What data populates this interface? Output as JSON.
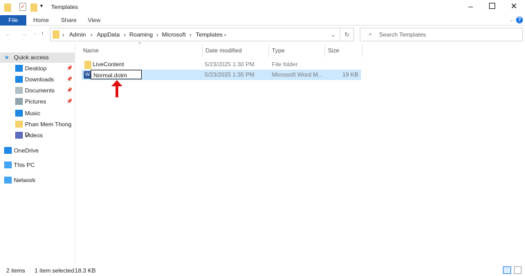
{
  "window": {
    "title": "Templates"
  },
  "ribbon": {
    "tabs": [
      "File",
      "Home",
      "Share",
      "View"
    ]
  },
  "address": {
    "crumbs": [
      "Admin",
      "AppData",
      "Roaming",
      "Microsoft",
      "Templates"
    ]
  },
  "search": {
    "placeholder": "Search Templates"
  },
  "columns": [
    "Name",
    "Date modified",
    "Type",
    "Size"
  ],
  "files": [
    {
      "name": "LiveContent",
      "date": "5/23/2025 1:30 PM",
      "type": "File folder",
      "size": ""
    },
    {
      "name": "Normal.dotm",
      "date": "5/23/2025 1:35 PM",
      "type": "Microsoft Word M...",
      "size": "19 KB"
    }
  ],
  "sidebar": {
    "items": [
      {
        "label": "Quick access",
        "icon": "star-icon"
      },
      {
        "label": "Desktop",
        "icon": "desktop-icon",
        "color": "#1e88e5"
      },
      {
        "label": "Downloads",
        "icon": "download-icon",
        "color": "#1e88e5"
      },
      {
        "label": "Documents",
        "icon": "document-icon",
        "color": "#b0bec5"
      },
      {
        "label": "Pictures",
        "icon": "pictures-icon",
        "color": "#90a4ae"
      },
      {
        "label": "Music",
        "icon": "music-icon",
        "color": "#1e88e5"
      },
      {
        "label": "Phan Mem Thong D",
        "icon": "folder-icon",
        "color": "#f5d26b"
      },
      {
        "label": "Videos",
        "icon": "videos-icon",
        "color": "#5c6bc0"
      },
      {
        "label": "OneDrive",
        "icon": "cloud-icon",
        "color": "#1e88e5"
      },
      {
        "label": "This PC",
        "icon": "computer-icon",
        "color": "#42a5f5"
      },
      {
        "label": "Network",
        "icon": "network-icon",
        "color": "#42a5f5"
      }
    ]
  },
  "status": {
    "items": "2 items",
    "selected": "1 item selected",
    "size": "18.3 KB"
  },
  "colors": {
    "file_tab": "#1a5fb4",
    "selection": "#cce8ff",
    "arrow": "#e01010"
  }
}
